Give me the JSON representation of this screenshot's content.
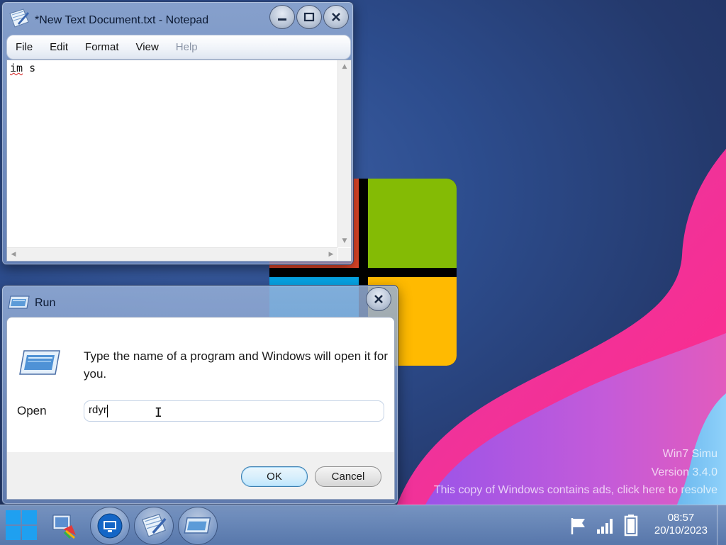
{
  "desktop": {
    "watermark_lines": [
      "Win7 Simu",
      "Version 3.4.0",
      "This copy of Windows contains ads, click here to resolve"
    ]
  },
  "notepad": {
    "title": "*New Text Document.txt - Notepad",
    "menu": [
      "File",
      "Edit",
      "Format",
      "View",
      "Help"
    ],
    "menu_disabled": [
      "Help"
    ],
    "content_word1": "im",
    "content_word2": " s"
  },
  "run": {
    "title": "Run",
    "prompt": "Type the name of a program and Windows will open it for you.",
    "open_label": "Open",
    "open_value": "rdyr",
    "ok_label": "OK",
    "cancel_label": "Cancel"
  },
  "taskbar": {
    "time": "08:57",
    "date": "20/10/2023",
    "items": [
      "start-icon",
      "paint-icon",
      "remote-desktop-icon",
      "notepad-icon",
      "run-icon"
    ],
    "tray_icons": [
      "action-center-flag-icon",
      "network-signal-icon",
      "battery-icon"
    ]
  },
  "colors": {
    "logo_red": "#e8472a",
    "logo_green": "#84bb05",
    "logo_blue": "#06a6e8",
    "logo_yellow": "#ffba01"
  }
}
